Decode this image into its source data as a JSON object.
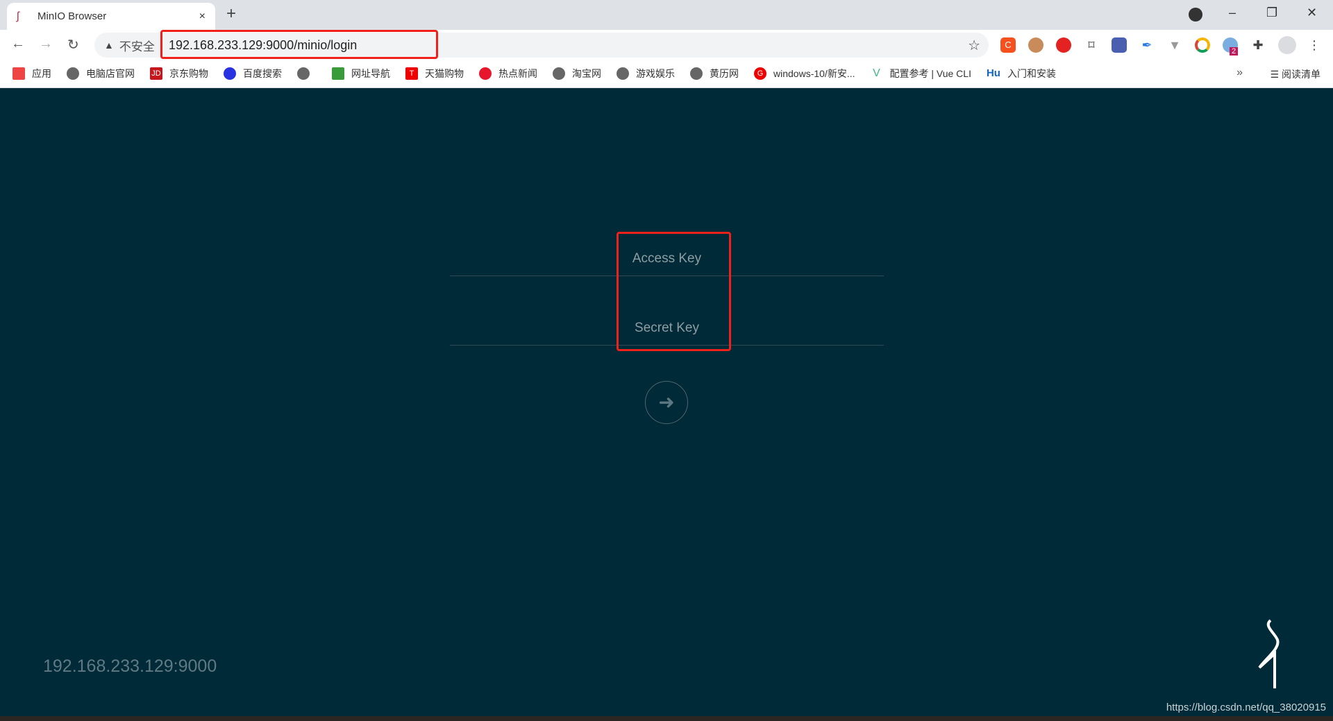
{
  "browser": {
    "tab": {
      "title": "MinIO Browser",
      "close": "×"
    },
    "new_tab": "+",
    "window_controls": {
      "minimize": "–",
      "restore": "❐",
      "close": "✕"
    },
    "address": {
      "security_label": "不安全",
      "url": "192.168.233.129:9000/minio/login"
    },
    "extension_badge": "2",
    "bookmarks": [
      "应用",
      "电脑店官网",
      "京东购物",
      "百度搜索",
      "",
      "网址导航",
      "天猫购物",
      "热点新闻",
      "淘宝网",
      "游戏娱乐",
      "黄历网",
      "windows-10/新安...",
      "配置参考 | Vue CLI",
      "入门和安装"
    ],
    "bookmark_overflow": "»",
    "reading_list": "阅读清单"
  },
  "login": {
    "access_key_placeholder": "Access Key",
    "secret_key_placeholder": "Secret Key"
  },
  "footer": {
    "host": "192.168.233.129:9000"
  },
  "watermark": "https://blog.csdn.net/qq_38020915",
  "colors": {
    "background": "#002a37",
    "highlight": "#f0201a"
  }
}
